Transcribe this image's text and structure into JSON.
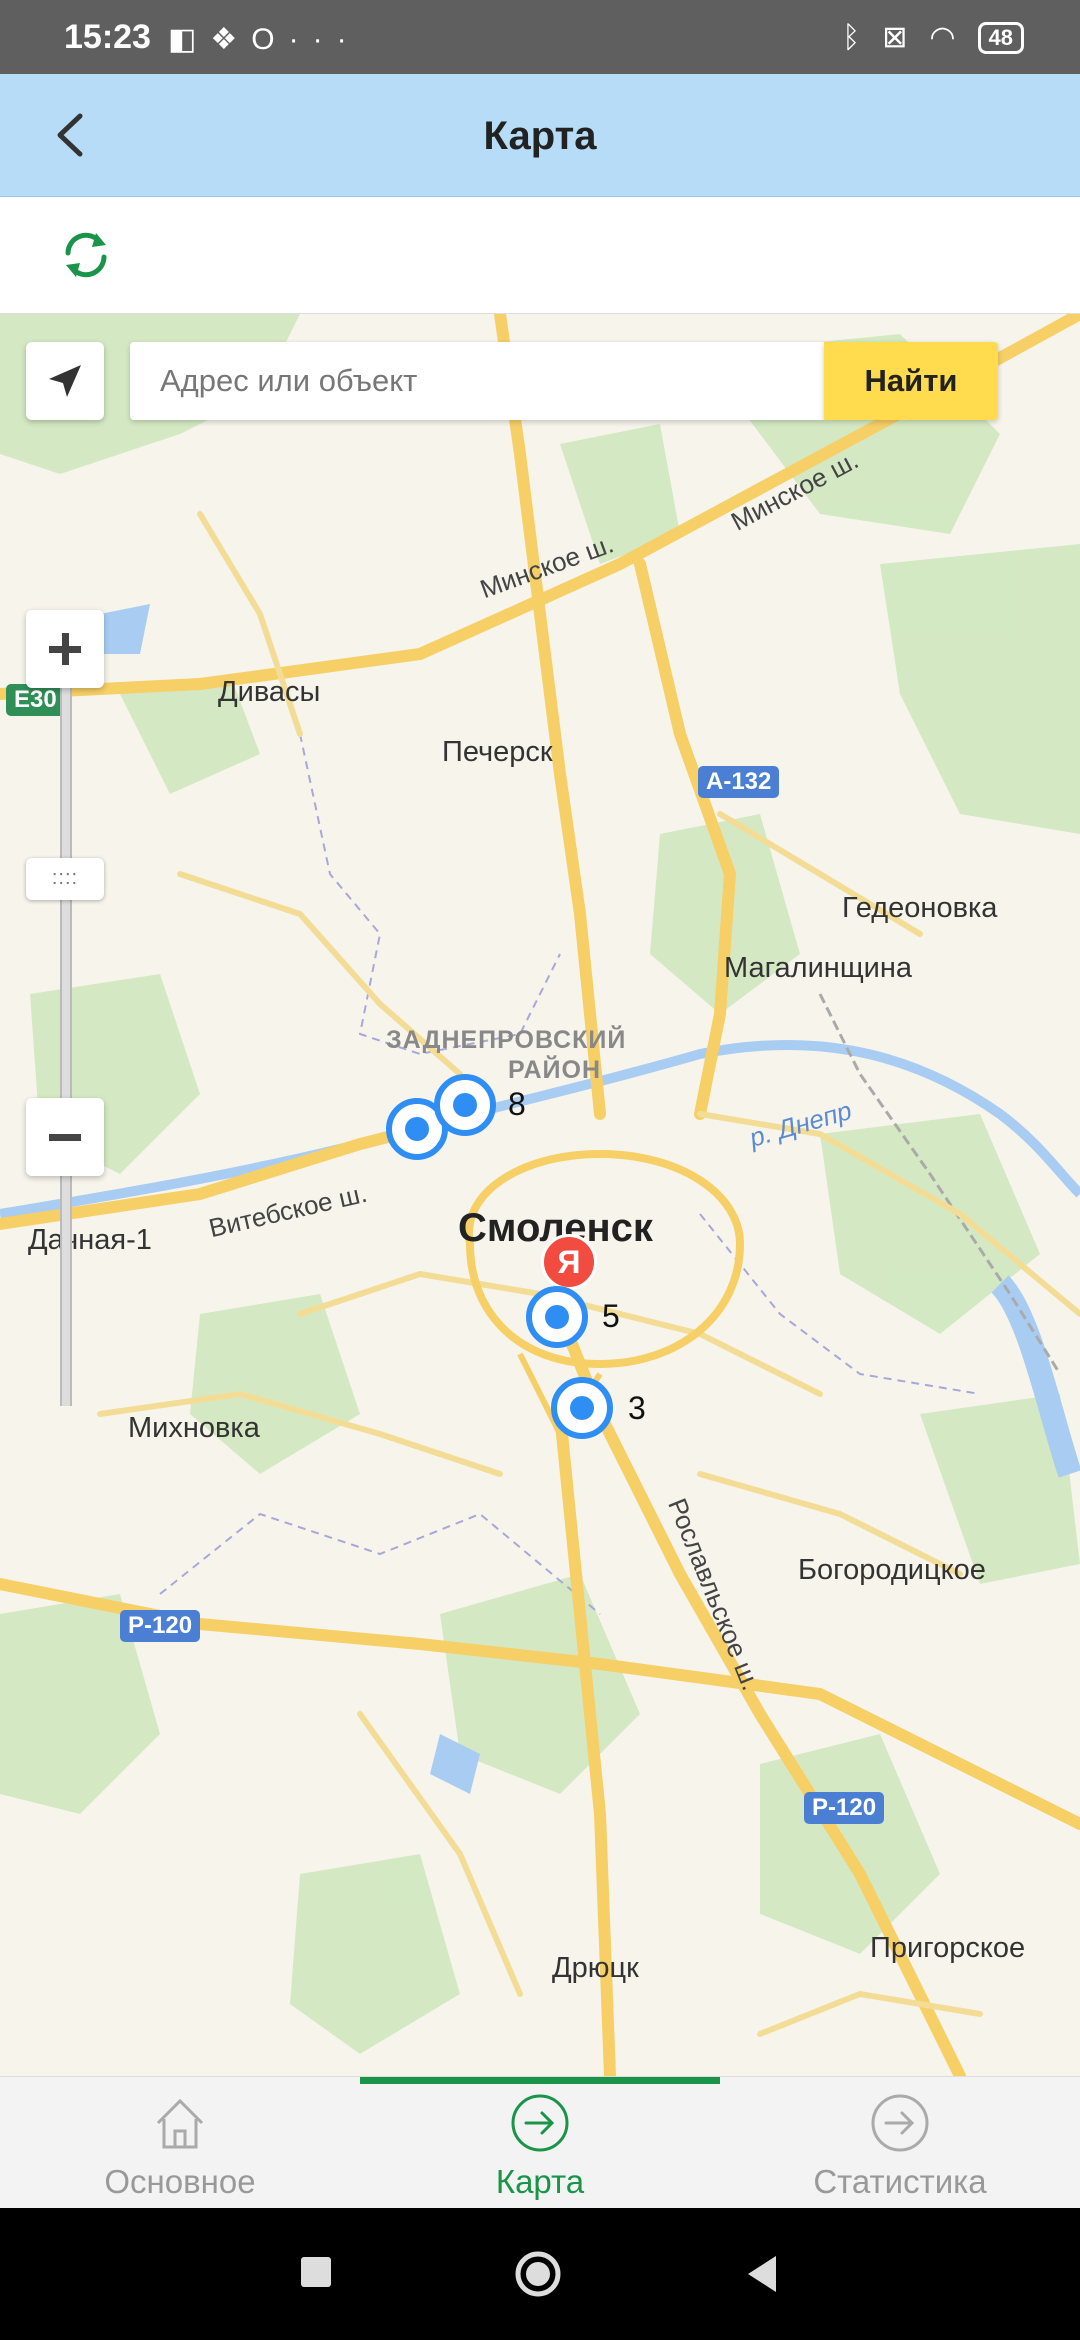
{
  "status_bar": {
    "time": "15:23",
    "left_icons": [
      "app-icon",
      "dropbox-icon",
      "opera-icon",
      "more-dots-icon"
    ],
    "battery": "48",
    "right_icons": [
      "bluetooth-icon",
      "sim-off-icon",
      "wifi-icon",
      "battery-icon"
    ]
  },
  "appbar": {
    "title": "Карта"
  },
  "map": {
    "search": {
      "placeholder": "Адрес или объект",
      "button": "Найти"
    },
    "labels": {
      "divasy": "Дивасы",
      "pechersk": "Печерск",
      "gedeonovka": "Гедеоновка",
      "magalinshina": "Магалинщина",
      "zadneprovsky": "ЗАДНЕПРОВСКИЙ",
      "rayon": "РАЙОН",
      "smolensk": "Смоленск",
      "dachnaya": "Дачная-1",
      "mikhnovka": "Михновка",
      "bogoroditskoe": "Богородицкое",
      "dryuck": "Дрюцк",
      "prigorskoe": "Пригорское",
      "minskoe1": "Минское ш.",
      "minskoe2": "Минское ш.",
      "vitebskoe": "Витебское ш.",
      "roslavlskoe": "Рославльское ш.",
      "dnepr": "р. Днепр"
    },
    "shields": {
      "e30": "E30",
      "a132": "А-132",
      "r120a": "Р-120",
      "r120b": "Р-120"
    },
    "markers": {
      "m1": "8",
      "m2": "5",
      "m3": "3"
    },
    "yandex_logo": "Я",
    "zoom_handle": "::::"
  },
  "bottom_nav": {
    "items": [
      {
        "label": "Основное",
        "icon": "home-icon",
        "active": false
      },
      {
        "label": "Карта",
        "icon": "arrow-circle-icon",
        "active": true
      },
      {
        "label": "Статистика",
        "icon": "arrow-circle-icon",
        "active": false
      }
    ]
  },
  "colors": {
    "accent": "#1a9448",
    "appbar": "#b6dcf7",
    "marker": "#2f8ef4",
    "find_button": "#ffdb4d"
  }
}
